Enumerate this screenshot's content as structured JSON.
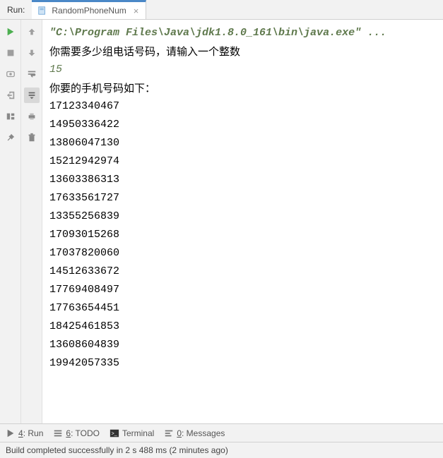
{
  "topbar": {
    "run_label": "Run:"
  },
  "tab": {
    "name": "RandomPhoneNum"
  },
  "console": {
    "command": "\"C:\\Program Files\\Java\\jdk1.8.0_161\\bin\\java.exe\" ...",
    "prompt1": "你需要多少组电话号码，请输入一个整数",
    "input_value": "15",
    "prompt2": "你要的手机号码如下：",
    "numbers": [
      "17123340467",
      "14950336422",
      "13806047130",
      "15212942974",
      "13603386313",
      "17633561727",
      "13355256839",
      "17093015268",
      "17037820060",
      "14512633672",
      "17769408497",
      "17763654451",
      "18425461853",
      "13608604839",
      "19942057335"
    ]
  },
  "bottom": {
    "run_num": "4",
    "run_label": ": Run",
    "todo_num": "6",
    "todo_label": ": TODO",
    "terminal_label": "Terminal",
    "messages_num": "0",
    "messages_label": ": Messages"
  },
  "status": {
    "text": "Build completed successfully in 2 s 488 ms (2 minutes ago)"
  }
}
